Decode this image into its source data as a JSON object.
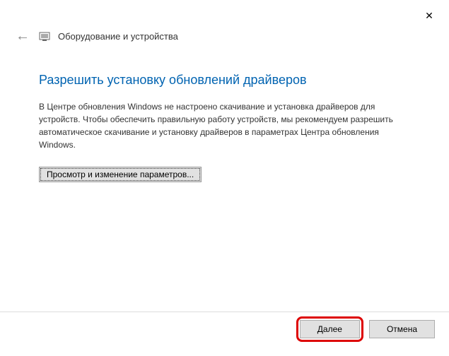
{
  "titlebar": {
    "close_label": "✕"
  },
  "header": {
    "back_glyph": "←",
    "title": "Оборудование и устройства"
  },
  "main": {
    "heading": "Разрешить установку обновлений драйверов",
    "description": "В Центре обновления Windows не настроено скачивание и установка драйверов для устройств. Чтобы обеспечить правильную работу устройств, мы рекомендуем разрешить автоматическое скачивание и установку драйверов в параметрах Центра обновления Windows.",
    "view_settings_label": "Просмотр и изменение параметров..."
  },
  "footer": {
    "next_label": "Далее",
    "cancel_label": "Отмена"
  }
}
